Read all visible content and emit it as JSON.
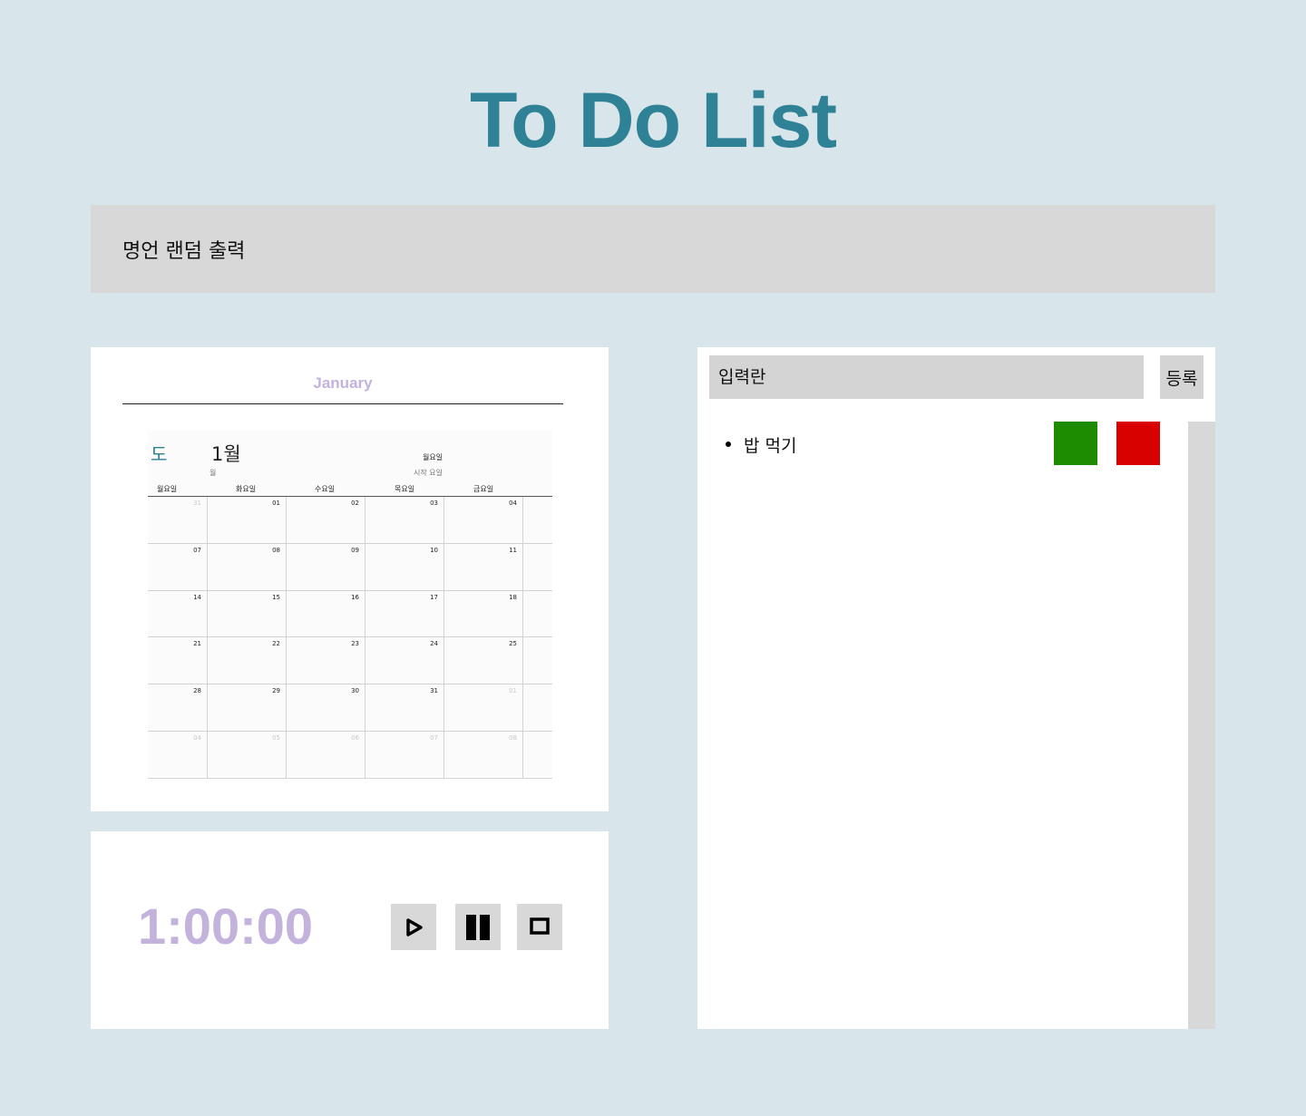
{
  "header": {
    "title": "To Do List"
  },
  "quote": {
    "text": "명언 랜덤 출력"
  },
  "calendar": {
    "heading": "January",
    "logo": "도",
    "month_label": "1월",
    "month_sub": "월",
    "start_day": "월요일",
    "start_day_label": "시작 요일",
    "weekdays": [
      "월요일",
      "화요일",
      "수요일",
      "목요일",
      "금요일"
    ],
    "weeks": [
      [
        {
          "d": "31",
          "dim": true
        },
        {
          "d": "01"
        },
        {
          "d": "02"
        },
        {
          "d": "03"
        },
        {
          "d": "04"
        }
      ],
      [
        {
          "d": "07"
        },
        {
          "d": "08"
        },
        {
          "d": "09"
        },
        {
          "d": "10"
        },
        {
          "d": "11"
        }
      ],
      [
        {
          "d": "14"
        },
        {
          "d": "15"
        },
        {
          "d": "16"
        },
        {
          "d": "17"
        },
        {
          "d": "18"
        }
      ],
      [
        {
          "d": "21"
        },
        {
          "d": "22"
        },
        {
          "d": "23"
        },
        {
          "d": "24"
        },
        {
          "d": "25"
        }
      ],
      [
        {
          "d": "28"
        },
        {
          "d": "29"
        },
        {
          "d": "30"
        },
        {
          "d": "31"
        },
        {
          "d": "01",
          "dim": true
        }
      ],
      [
        {
          "d": "04",
          "dim": true
        },
        {
          "d": "05",
          "dim": true
        },
        {
          "d": "06",
          "dim": true
        },
        {
          "d": "07",
          "dim": true
        },
        {
          "d": "08",
          "dim": true
        }
      ]
    ]
  },
  "timer": {
    "display": "1:00:00",
    "buttons": [
      {
        "name": "play-button",
        "icon": "play-icon"
      },
      {
        "name": "pause-button",
        "icon": "pause-icon"
      },
      {
        "name": "stop-button",
        "icon": "stop-icon"
      }
    ]
  },
  "todo": {
    "input_placeholder": "입력란",
    "add_label": "등록",
    "items": [
      {
        "text": "밥 먹기",
        "done_color": "#1e8c00",
        "delete_color": "#d90000"
      }
    ]
  },
  "colors": {
    "background": "#d8e5ea",
    "accent": "#2f8195",
    "timer": "#c3b3dc"
  }
}
